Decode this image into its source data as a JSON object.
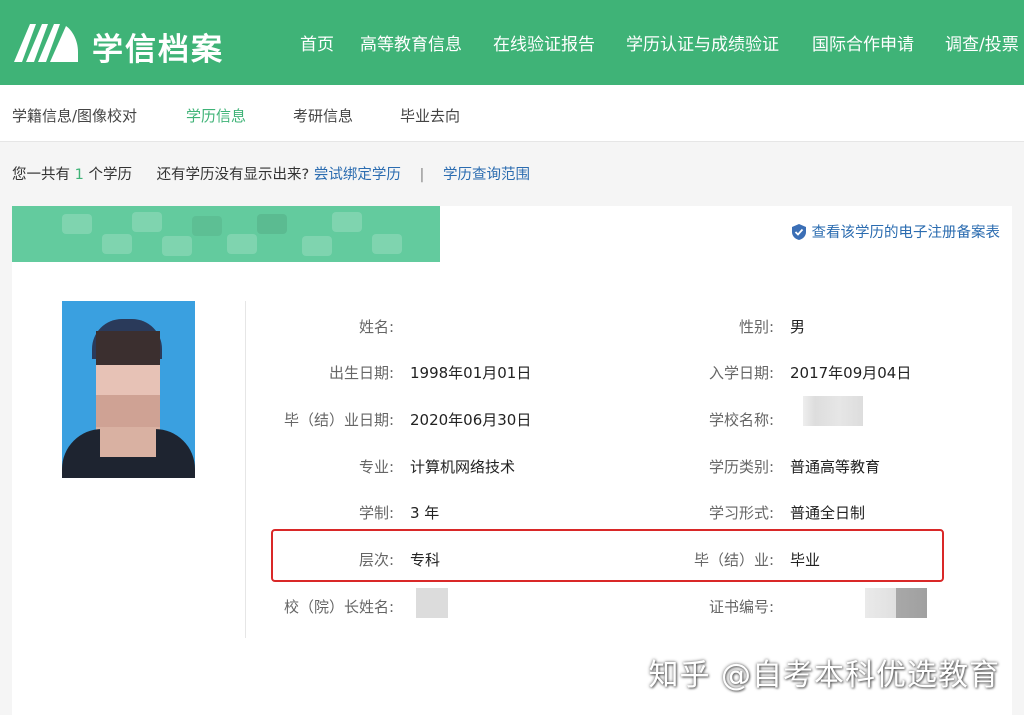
{
  "header": {
    "brand": "学信档案",
    "nav": [
      "首页",
      "高等教育信息",
      "在线验证报告",
      "学历认证与成绩验证",
      "国际合作申请",
      "调查/投票"
    ],
    "colors": {
      "primary": "#3fb377"
    }
  },
  "subnav": {
    "items": [
      "学籍信息/图像校对",
      "学历信息",
      "考研信息",
      "毕业去向"
    ],
    "active": "学历信息"
  },
  "summary": {
    "prefix": "您一共有",
    "count": "1",
    "suffix": "个学历",
    "hint": "还有学历没有显示出来?",
    "bind_link": "尝试绑定学历",
    "separator": "|",
    "scope_link": "学历查询范围"
  },
  "card": {
    "record_link": "查看该学历的电子注册备案表",
    "record_icon": "shield-check-icon",
    "left_fields": [
      {
        "label": "姓名:",
        "value": ""
      },
      {
        "label": "出生日期:",
        "value": "1998年01月01日"
      },
      {
        "label": "毕（结）业日期:",
        "value": "2020年06月30日"
      },
      {
        "label": "专业:",
        "value": "计算机网络技术"
      },
      {
        "label": "学制:",
        "value": "3 年"
      },
      {
        "label": "层次:",
        "value": "专科"
      },
      {
        "label": "校（院）长姓名:",
        "value": ""
      }
    ],
    "right_fields": [
      {
        "label": "性别:",
        "value": "男"
      },
      {
        "label": "入学日期:",
        "value": "2017年09月04日"
      },
      {
        "label": "学校名称:",
        "value": ""
      },
      {
        "label": "学历类别:",
        "value": "普通高等教育"
      },
      {
        "label": "学习形式:",
        "value": "普通全日制"
      },
      {
        "label": "毕（结）业:",
        "value": "毕业"
      },
      {
        "label": "证书编号:",
        "value": ""
      }
    ]
  },
  "watermark": "知乎 @自考本科优选教育"
}
